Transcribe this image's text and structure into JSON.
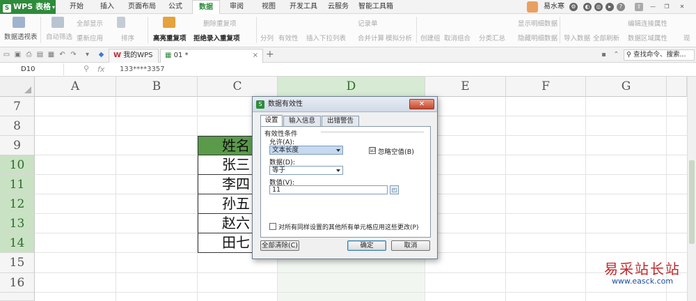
{
  "app": {
    "name": "WPS 表格",
    "logo_letter": "S"
  },
  "menu": [
    "开始",
    "插入",
    "页面布局",
    "公式",
    "数据",
    "审阅",
    "视图",
    "开发工具",
    "云服务",
    "智能工具箱"
  ],
  "menu_active": "数据",
  "user": {
    "name": "易水寒",
    "help": "?"
  },
  "ribbon": {
    "pivot": "数据透视表",
    "autofilter": "自动筛选",
    "show_all": "全部显示",
    "reapply": "重新应用",
    "sort": "排序",
    "highlight_dup": "高亮重复项",
    "delete_dup": "删除重复项",
    "reject_dup": "拒绝录入重复项",
    "split": "分列",
    "validity": "有效性",
    "dropdown": "插入下拉列表",
    "record": "记录单",
    "consolidate": "合并计算",
    "what_if": "模拟分析",
    "group": "创建组",
    "ungroup": "取消组合",
    "subtotal": "分类汇总",
    "show_detail": "显示明细数据",
    "hide_detail": "隐藏明细数据",
    "import": "导入数据",
    "refresh_all": "全部刷新",
    "edit_link": "编辑连接属性",
    "range_props": "数据区域属性",
    "more": "现"
  },
  "quickbar": {
    "tab_home": "我的WPS",
    "tab_doc": "01 *",
    "close": "×",
    "add": "+",
    "search": "查找命令、搜索..."
  },
  "formula_bar": {
    "cell_ref": "D10",
    "fx": "fx",
    "value": "133****3357"
  },
  "columns": [
    "A",
    "B",
    "C",
    "D",
    "E",
    "F",
    "G"
  ],
  "rows": [
    "7",
    "8",
    "9",
    "10",
    "11",
    "12",
    "13",
    "14",
    "15",
    "16"
  ],
  "table": {
    "header": "姓名",
    "names": [
      "张三",
      "李四",
      "孙五",
      "赵六",
      "田七"
    ]
  },
  "dialog": {
    "title": "数据有效性",
    "close": "✕",
    "tabs": [
      "设置",
      "输入信息",
      "出错警告"
    ],
    "group_label": "有效性条件",
    "allow_label": "允许(A):",
    "allow_value": "文本长度",
    "ignore_blank_label": "忽略空值(B)",
    "ignore_blank_checked": "☑",
    "data_label": "数据(D):",
    "data_value": "等于",
    "value_label": "数值(V):",
    "value_value": "11",
    "apply_all_label": "对所有同样设置的其他所有单元格应用这些更改(P)",
    "clear_all": "全部清除(C)",
    "ok": "确定",
    "cancel": "取消"
  },
  "watermark": {
    "main": "易采站长站",
    "sub": "www.easck.com"
  },
  "colors": {
    "accent": "#2e8b3b",
    "header_fill": "#5a9a4a",
    "selection": "#c9e2c3",
    "watermark": "#c0282b"
  }
}
